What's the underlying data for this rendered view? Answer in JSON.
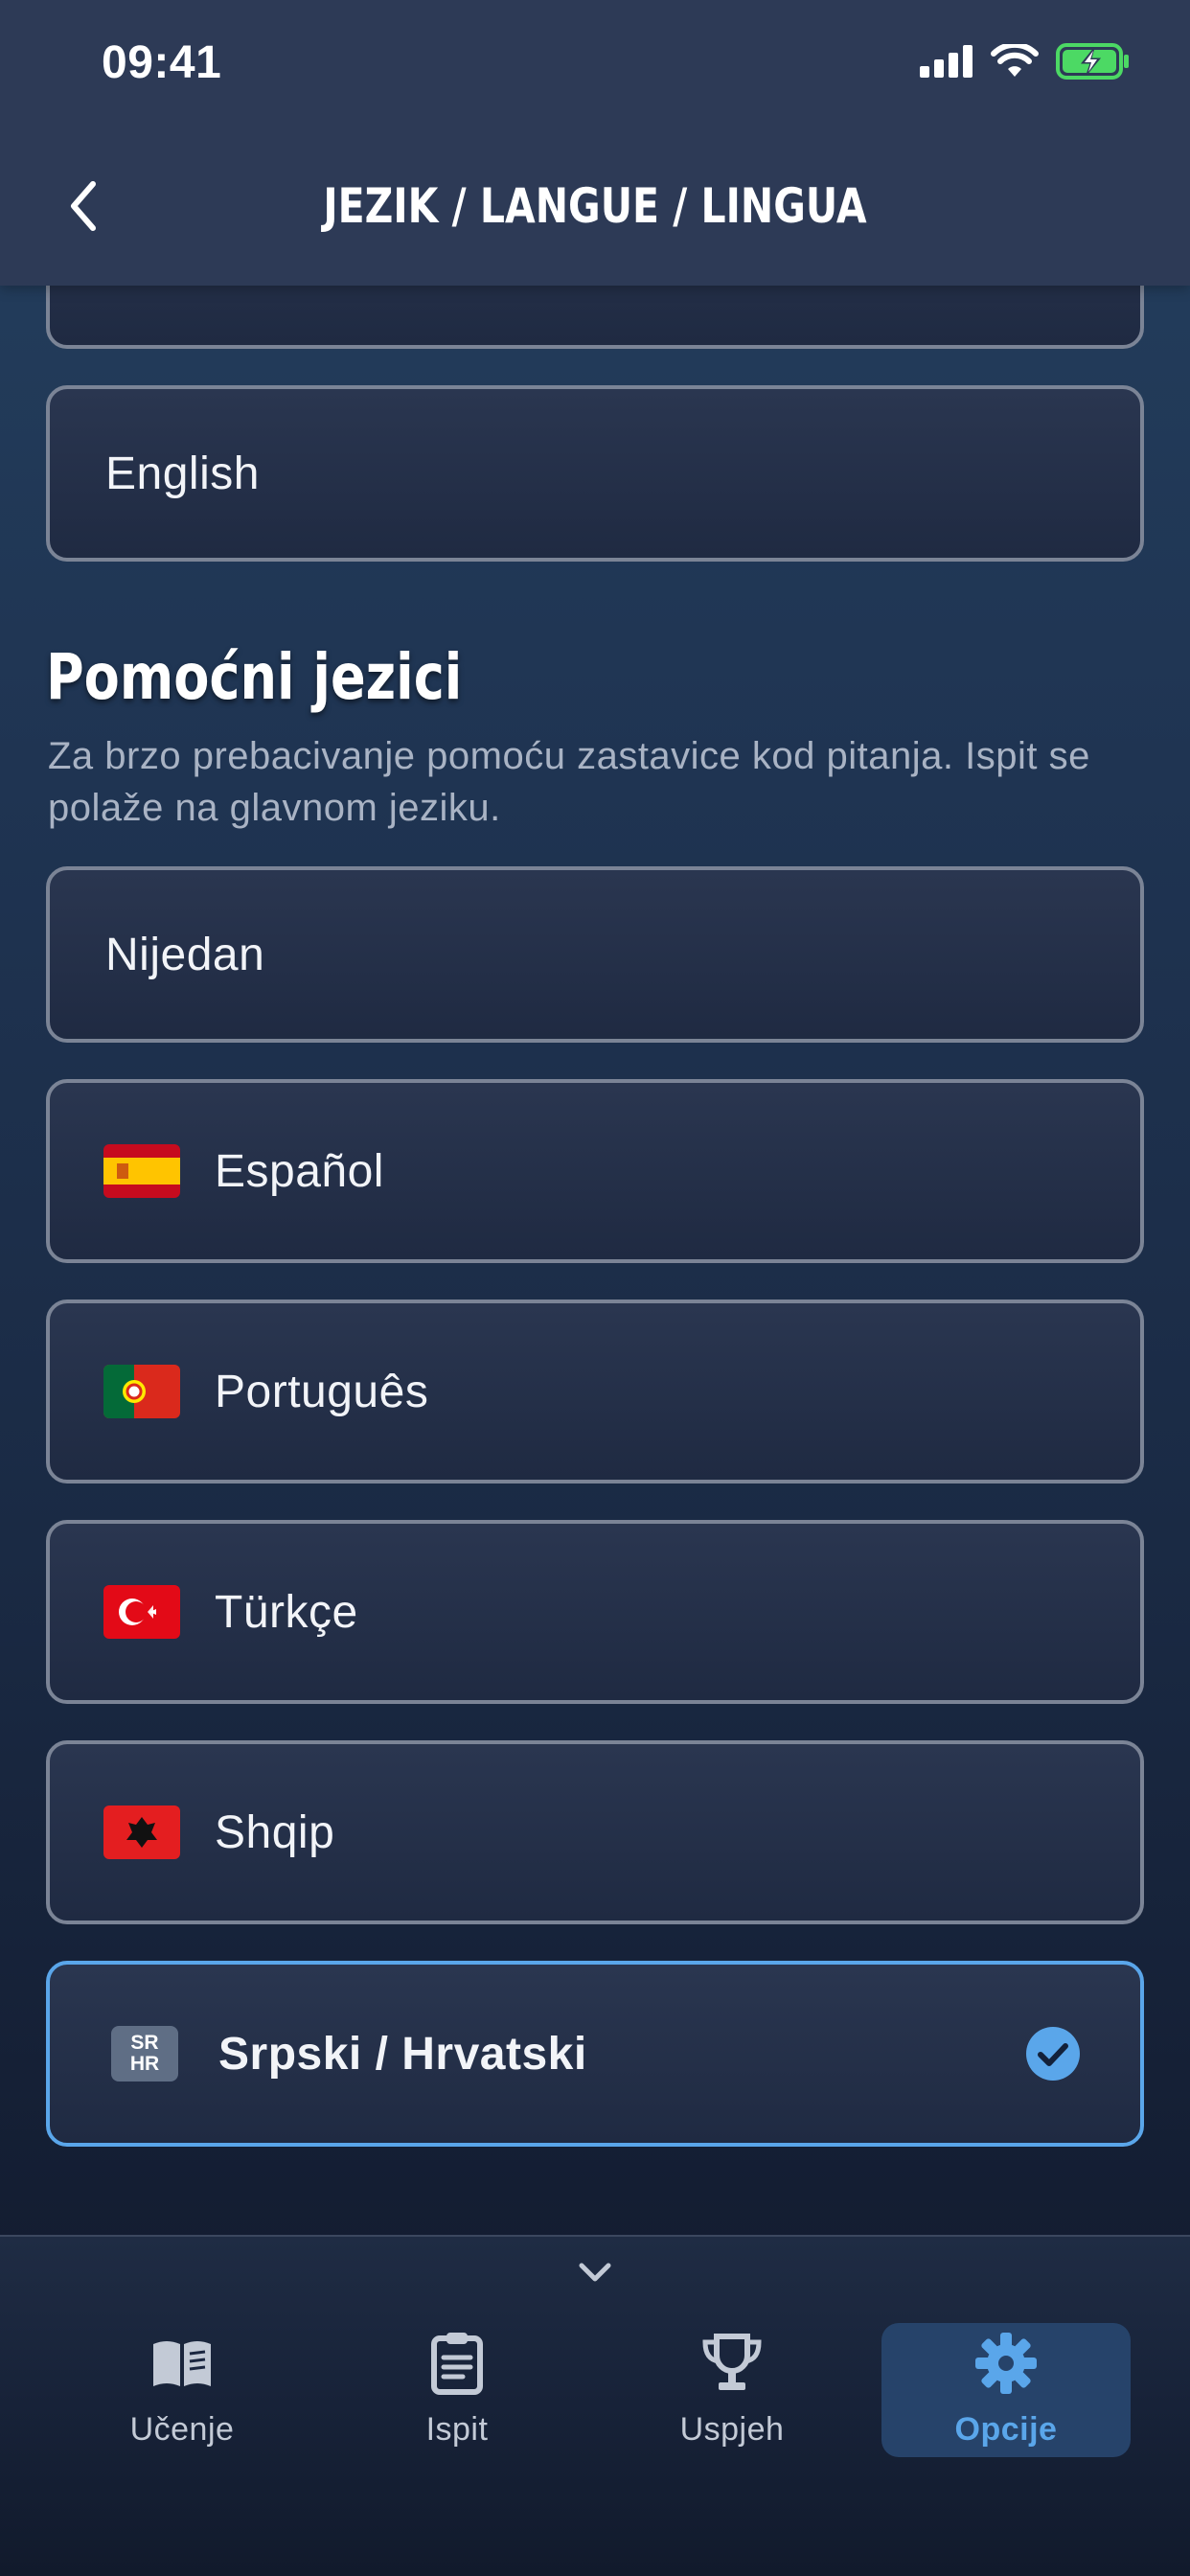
{
  "status_bar": {
    "time": "09:41"
  },
  "nav": {
    "title": "JEZIK / LANGUE / LINGUA"
  },
  "primary_section": {
    "options": [
      {
        "label": "English",
        "icon": "none"
      }
    ]
  },
  "secondary_section": {
    "title": "Pomoćni jezici",
    "description": "Za brzo prebacivanje pomoću zastavice kod pitanja. Ispit se polaže na glavnom jeziku.",
    "options": [
      {
        "label": "Nijedan",
        "flag": "none",
        "selected": false
      },
      {
        "label": "Español",
        "flag": "spain-flag-icon",
        "selected": false
      },
      {
        "label": "Português",
        "flag": "portugal-flag-icon",
        "selected": false
      },
      {
        "label": "Türkçe",
        "flag": "turkey-flag-icon",
        "selected": false
      },
      {
        "label": "Shqip",
        "flag": "albania-flag-icon",
        "selected": false
      },
      {
        "label": "Srpski / Hrvatski",
        "flag": "sr-hr-badge-icon",
        "badge_top": "SR",
        "badge_bottom": "HR",
        "selected": true
      }
    ]
  },
  "tabbar": {
    "tabs": [
      {
        "label": "Učenje",
        "icon": "book-icon",
        "active": false
      },
      {
        "label": "Ispit",
        "icon": "clipboard-icon",
        "active": false
      },
      {
        "label": "Uspjeh",
        "icon": "trophy-icon",
        "active": false
      },
      {
        "label": "Opcije",
        "icon": "gear-icon",
        "active": true
      }
    ]
  },
  "colors": {
    "accent": "#5aa6ea",
    "header_bg": "#2d3a56",
    "option_border": "#7b8496",
    "battery_green": "#4cd964"
  }
}
